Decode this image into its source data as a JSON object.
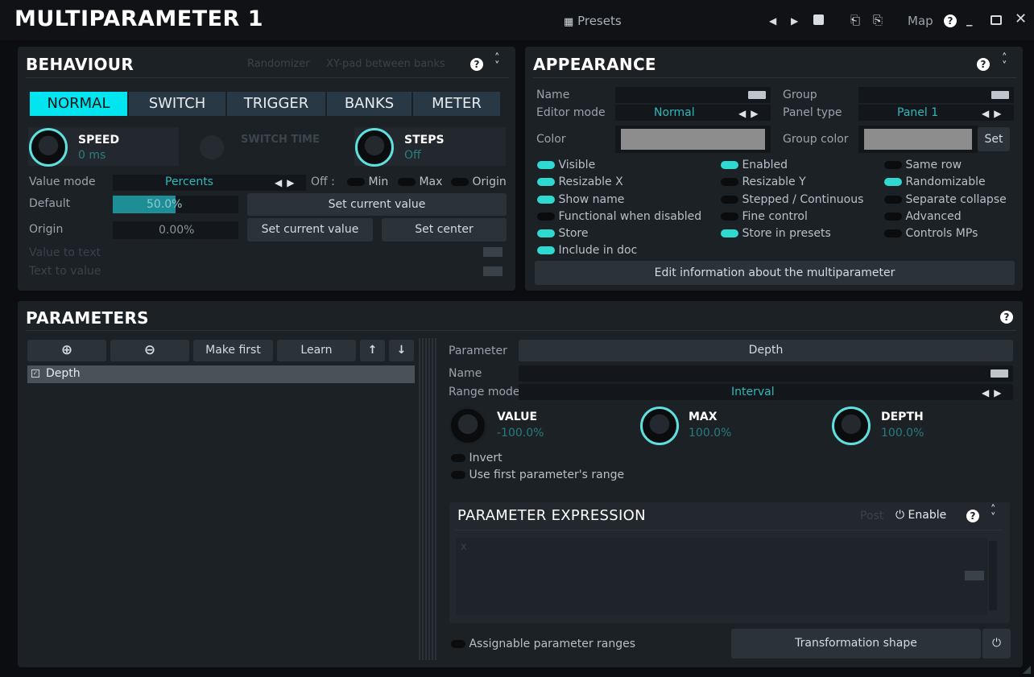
{
  "window": {
    "title": "MULTIPARAMETER 1",
    "presets_label": "Presets",
    "map_label": "Map"
  },
  "behaviour": {
    "title": "BEHAVIOUR",
    "randomizer": "Randomizer",
    "xy_pad": "XY-pad between banks",
    "modes": [
      "NORMAL",
      "SWITCH",
      "TRIGGER",
      "BANKS",
      "METER"
    ],
    "selected_mode": "NORMAL",
    "speed": {
      "label": "SPEED",
      "value": "0 ms"
    },
    "switch_time": {
      "label": "SWITCH TIME",
      "value": ""
    },
    "steps": {
      "label": "STEPS",
      "value": "Off"
    },
    "value_mode": {
      "label": "Value mode",
      "value": "Percents",
      "off": "Off :",
      "min": "Min",
      "max": "Max",
      "origin": "Origin"
    },
    "default": {
      "label": "Default",
      "value": "50.0%",
      "fill": 0.5,
      "button": "Set current value"
    },
    "origin": {
      "label": "Origin",
      "value": "0.00%",
      "button1": "Set current value",
      "button2": "Set center"
    },
    "value_to_text": "Value to text",
    "text_to_value": "Text to value"
  },
  "appearance": {
    "title": "APPEARANCE",
    "name_label": "Name",
    "name_value": "",
    "group_label": "Group",
    "group_value": "",
    "editor_mode_label": "Editor mode",
    "editor_mode_value": "Normal",
    "panel_type_label": "Panel type",
    "panel_type_value": "Panel 1",
    "color_label": "Color",
    "group_color_label": "Group color",
    "set_label": "Set",
    "col1": [
      {
        "label": "Visible",
        "on": true
      },
      {
        "label": "Resizable X",
        "on": true
      },
      {
        "label": "Show name",
        "on": true
      },
      {
        "label": "Functional when disabled",
        "on": false
      },
      {
        "label": "Store",
        "on": true
      },
      {
        "label": "Include in doc",
        "on": true
      }
    ],
    "col2": [
      {
        "label": "Enabled",
        "on": true
      },
      {
        "label": "Resizable Y",
        "on": false
      },
      {
        "label": "Stepped / Continuous",
        "on": false
      },
      {
        "label": "Fine control",
        "on": false
      },
      {
        "label": "Store in presets",
        "on": true
      }
    ],
    "col3": [
      {
        "label": "Same row",
        "on": false
      },
      {
        "label": "Randomizable",
        "on": true
      },
      {
        "label": "Separate collapse",
        "on": false
      },
      {
        "label": "Advanced",
        "on": false
      },
      {
        "label": "Controls MPs",
        "on": false
      }
    ],
    "edit_info": "Edit information about the multiparameter"
  },
  "parameters": {
    "title": "PARAMETERS",
    "make_first": "Make first",
    "learn": "Learn",
    "list": [
      "Depth"
    ],
    "parameter_label": "Parameter",
    "parameter_value": "Depth",
    "name_label": "Name",
    "range_mode_label": "Range mode",
    "range_mode_value": "Interval",
    "value_knob": {
      "label": "VALUE",
      "value": "-100.0%"
    },
    "max_knob": {
      "label": "MAX",
      "value": "100.0%"
    },
    "depth_knob": {
      "label": "DEPTH",
      "value": "100.0%"
    },
    "invert": "Invert",
    "use_first": "Use first parameter's range",
    "expression": {
      "title": "PARAMETER EXPRESSION",
      "post": "Post",
      "enable": "Enable",
      "text": "x"
    },
    "assignable": "Assignable parameter ranges",
    "transformation": "Transformation shape"
  },
  "colors": {
    "accent": "#00e5f0",
    "panel": "#1c2126",
    "background": "#0b0d10"
  }
}
